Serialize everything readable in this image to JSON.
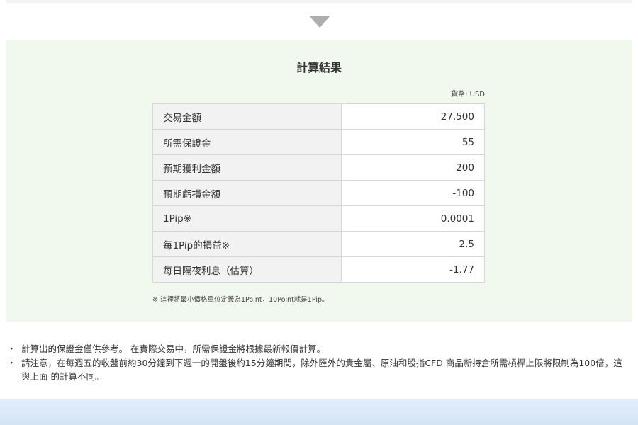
{
  "result": {
    "title": "計算結果",
    "currency": "貨幣: USD",
    "rows": [
      {
        "label": "交易金額",
        "value": "27,500"
      },
      {
        "label": "所需保證金",
        "value": "55"
      },
      {
        "label": "預期獲利金額",
        "value": "200"
      },
      {
        "label": "預期虧損金額",
        "value": "-100"
      },
      {
        "label": "1Pip※",
        "value": "0.0001"
      },
      {
        "label": "每1Pip的損益※",
        "value": "2.5"
      },
      {
        "label": "每日隔夜利息（估算）",
        "value": "-1.77"
      }
    ],
    "footnote": "※ 這裡將最小價格單位定義為1Point，10Point就是1Pip。"
  },
  "notes": [
    {
      "bullet": "・",
      "text": "計算出的保證金僅供參考。 在實際交易中，所需保證金將根據最新報價計算。"
    },
    {
      "bullet": "・",
      "text": "請注意，在每週五的收盤前約30分鐘到下週一的開盤後約15分鐘期間，除外匯外的貴金屬、原油和股指CFD 商品新持倉所需槓桿上限將限制為100倍，這與上面 的計算不同。"
    }
  ],
  "icons": {
    "arrow": "triangle-down-icon"
  }
}
